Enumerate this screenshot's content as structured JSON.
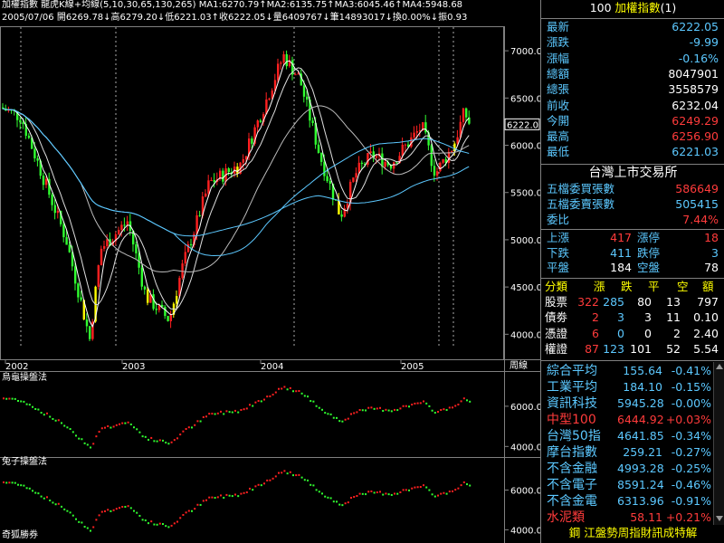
{
  "header": {
    "line1": "加權指數 龍虎K線+均線(5,10,30,65,130,265) MA1:6270.79↑MA2:6135.75↑MA3:6045.46↑MA4:5948.68",
    "line2": "2005/07/06 開6269.78↓高6279.20↓低6221.03↑收6222.05↓量6409767↓筆14893017↓換0.00%↓振0.93"
  },
  "main_chart": {
    "y_ticks": [
      "7000.0",
      "6500.0",
      "6000.0",
      "5500.0",
      "5000.0",
      "4500.0",
      "4000.0"
    ],
    "y_values": [
      7000,
      6500,
      6000,
      5500,
      5000,
      4500,
      4000
    ],
    "y_range": [
      3850,
      7250
    ],
    "current_price_label": "6222.0",
    "x_labels": [
      "2002",
      "2003",
      "2004",
      "2005"
    ],
    "x_period_label": "周線"
  },
  "sub1": {
    "title": "烏龜操盤法",
    "y_ticks": [
      "6000.0",
      "4000.0"
    ]
  },
  "sub2": {
    "title": "兔子操盤法",
    "y_ticks": [
      "6000.0",
      "4000.0"
    ]
  },
  "footer_label": "奇狐勝券",
  "side": {
    "title_code": "100",
    "title_name": "加權指數",
    "title_suffix": "(1)",
    "quotes": [
      {
        "label": "最新",
        "value": "6222.05",
        "color": "#5cc8ff"
      },
      {
        "label": "漲跌",
        "value": "-9.99",
        "color": "#5cc8ff"
      },
      {
        "label": "漲幅",
        "value": "-0.16%",
        "color": "#5cc8ff"
      },
      {
        "label": "總額",
        "value": "8047901",
        "color": "#ffffff"
      },
      {
        "label": "總張",
        "value": "3558579",
        "color": "#ffffff"
      },
      {
        "label": "前收",
        "value": "6232.04",
        "color": "#ffffff"
      },
      {
        "label": "今開",
        "value": "6249.29",
        "color": "#ff3b3b"
      },
      {
        "label": "最高",
        "value": "6256.90",
        "color": "#ff3b3b"
      },
      {
        "label": "最低",
        "value": "6221.03",
        "color": "#5cc8ff"
      }
    ],
    "exchange": "台灣上市交易所",
    "five_buy_label": "五檔委買張數",
    "five_buy_value": "586649",
    "five_sell_label": "五檔委賣張數",
    "five_sell_value": "505415",
    "ratio_label": "委比",
    "ratio_value": "7.44%",
    "breadth": [
      {
        "l1": "上漲",
        "v1": "417",
        "l2": "漲停",
        "v2": "18"
      },
      {
        "l1": "下跌",
        "v1": "411",
        "l2": "跌停",
        "v2": "3"
      },
      {
        "l1": "平盤",
        "v1": "184",
        "l2": "空盤",
        "v2": "78"
      }
    ],
    "cat_header": [
      "分類",
      "漲",
      "跌",
      "平",
      "空",
      "額"
    ],
    "categories": [
      {
        "name": "股票",
        "up": "322",
        "down": "285",
        "flat": "80",
        "empty": "13",
        "amt": "797"
      },
      {
        "name": "債劵",
        "up": "2",
        "down": "3",
        "flat": "3",
        "empty": "11",
        "amt": "0.10"
      },
      {
        "name": "憑證",
        "up": "6",
        "down": "0",
        "flat": "0",
        "empty": "2",
        "amt": "2.40"
      },
      {
        "name": "權證",
        "up": "87",
        "down": "123",
        "flat": "101",
        "empty": "52",
        "amt": "5.54"
      }
    ],
    "indices": [
      {
        "name": "綜合平均",
        "value": "155.64",
        "chg": "-0.41%",
        "color": "#5cc8ff"
      },
      {
        "name": "工業平均",
        "value": "184.10",
        "chg": "-0.15%",
        "color": "#5cc8ff"
      },
      {
        "name": "資訊科技",
        "value": "5945.28",
        "chg": "-0.00%",
        "color": "#5cc8ff"
      },
      {
        "name": "中型100",
        "value": "6444.92",
        "chg": "+0.03%",
        "color": "#ff3b3b"
      },
      {
        "name": "台灣50指",
        "value": "4641.85",
        "chg": "-0.34%",
        "color": "#5cc8ff"
      },
      {
        "name": "摩台指數",
        "value": "259.21",
        "chg": "-0.27%",
        "color": "#5cc8ff"
      },
      {
        "name": "不含金融",
        "value": "4993.28",
        "chg": "-0.25%",
        "color": "#5cc8ff"
      },
      {
        "name": "不含電子",
        "value": "8591.24",
        "chg": "-0.46%",
        "color": "#5cc8ff"
      },
      {
        "name": "不含金電",
        "value": "6313.96",
        "chg": "-0.91%",
        "color": "#5cc8ff"
      },
      {
        "name": "水泥類",
        "value": "58.11",
        "chg": "+0.21%",
        "color": "#ff3b3b"
      }
    ],
    "ticker": "鋼 江盤勢周指財訊成特解"
  },
  "colors": {
    "up": "#ff2020",
    "down": "#30ff30",
    "neutral": "#ffff00",
    "ma": "#5cc8ff",
    "grid": "#808080"
  }
}
